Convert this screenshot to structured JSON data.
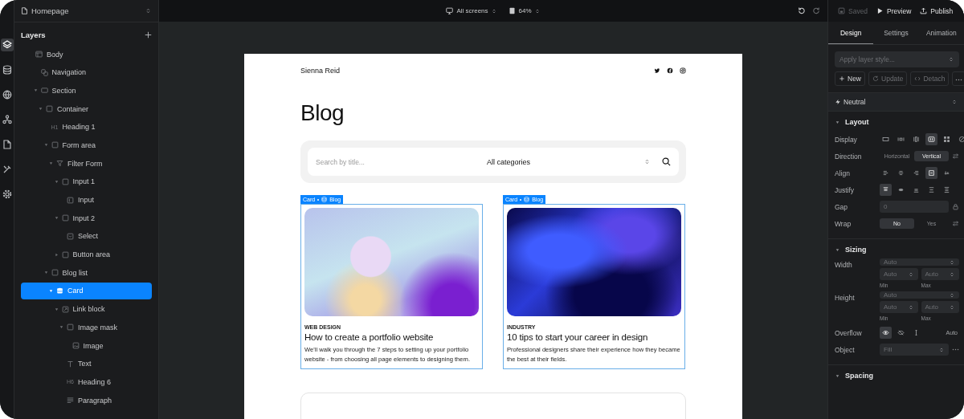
{
  "rail": [
    {
      "kind": "layers",
      "selected": true
    },
    {
      "kind": "database",
      "selected": false
    },
    {
      "kind": "globe",
      "selected": false
    },
    {
      "kind": "components",
      "selected": false
    },
    {
      "kind": "pages",
      "selected": false
    },
    {
      "kind": "tools",
      "selected": false
    },
    {
      "kind": "settings",
      "selected": false
    }
  ],
  "page_selector": {
    "label": "Homepage"
  },
  "layers": {
    "title": "Layers",
    "items": [
      {
        "label": "Body",
        "kind": "frame",
        "selected": false,
        "children": [
          {
            "label": "Navigation",
            "kind": "component",
            "selected": false
          },
          {
            "label": "Section",
            "kind": "section",
            "selected": false,
            "expanded": true,
            "children": [
              {
                "label": "Container",
                "kind": "box",
                "selected": false,
                "expanded": true,
                "children": [
                  {
                    "label": "Heading 1",
                    "kind": "heading",
                    "badge": "H1",
                    "selected": false
                  },
                  {
                    "label": "Form area",
                    "kind": "box",
                    "selected": false,
                    "expanded": true,
                    "children": [
                      {
                        "label": "Filter Form",
                        "kind": "filter",
                        "selected": false,
                        "expanded": true,
                        "children": [
                          {
                            "label": "Input 1",
                            "kind": "box",
                            "selected": false,
                            "expanded": true,
                            "children": [
                              {
                                "label": "Input",
                                "kind": "input",
                                "selected": false
                              }
                            ]
                          },
                          {
                            "label": "Input 2",
                            "kind": "box",
                            "selected": false,
                            "expanded": true,
                            "children": [
                              {
                                "label": "Select",
                                "kind": "select",
                                "selected": false
                              }
                            ]
                          },
                          {
                            "label": "Button area",
                            "kind": "box",
                            "selected": false,
                            "expanded": false
                          }
                        ]
                      }
                    ]
                  },
                  {
                    "label": "Blog list",
                    "kind": "box",
                    "selected": false,
                    "expanded": true,
                    "children": [
                      {
                        "label": "Card",
                        "kind": "collection",
                        "selected": true,
                        "expanded": true,
                        "children": [
                          {
                            "label": "Link block",
                            "kind": "link",
                            "selected": false,
                            "expanded": true,
                            "children": [
                              {
                                "label": "Image mask",
                                "kind": "box",
                                "selected": false,
                                "expanded": true,
                                "children": [
                                  {
                                    "label": "Image",
                                    "kind": "image",
                                    "selected": false
                                  }
                                ]
                              },
                              {
                                "label": "Text",
                                "kind": "text",
                                "selected": false
                              },
                              {
                                "label": "Heading 6",
                                "kind": "heading",
                                "badge": "H6",
                                "selected": false
                              },
                              {
                                "label": "Paragraph",
                                "kind": "paragraph",
                                "selected": false
                              }
                            ]
                          }
                        ]
                      }
                    ]
                  }
                ]
              }
            ]
          }
        ]
      }
    ]
  },
  "toolbar": {
    "screens": "All screens",
    "zoom": "64%"
  },
  "canvas": {
    "brand": "Sienna Reid",
    "heading": "Blog",
    "search": {
      "placeholder": "Search by title...",
      "category": "All categories"
    },
    "cards": [
      {
        "tag": {
          "element": "Card",
          "collection": "Blog"
        },
        "category": "WEB DESIGN",
        "title": "How to create a portfolio website",
        "text": "We'll walk you through the 7 steps to setting up your portfolio website - from choosing all page elements to designing them."
      },
      {
        "tag": {
          "element": "Card",
          "collection": "Blog"
        },
        "category": "INDUSTRY",
        "title": "10 tips to start your career in design",
        "text": "Professional designers share their experience how they became the best at their fields."
      }
    ]
  },
  "actions": [
    {
      "label": "Saved",
      "kind": "saved",
      "disabled": true
    },
    {
      "label": "Preview",
      "kind": "preview",
      "disabled": false
    },
    {
      "label": "Publish",
      "kind": "publish",
      "disabled": false
    }
  ],
  "tabs": [
    {
      "label": "Design",
      "selected": true
    },
    {
      "label": "Settings",
      "selected": false
    },
    {
      "label": "Animation",
      "selected": false
    }
  ],
  "layer_style": {
    "placeholder": "Apply layer style..."
  },
  "style_buttons": [
    {
      "label": "New",
      "kind": "new",
      "disabled": false
    },
    {
      "label": "Update",
      "kind": "update",
      "disabled": true
    },
    {
      "label": "Detach",
      "kind": "detach",
      "disabled": true
    }
  ],
  "variant": "Neutral",
  "layout": {
    "title": "Layout",
    "display": {
      "label": "Display",
      "options": [
        {
          "kind": "block",
          "selected": false
        },
        {
          "kind": "inline-block",
          "selected": false
        },
        {
          "kind": "inline",
          "selected": false
        },
        {
          "kind": "flex",
          "selected": true
        },
        {
          "kind": "grid",
          "selected": false
        },
        {
          "kind": "none",
          "selected": false
        }
      ]
    },
    "direction": {
      "label": "Direction",
      "options": [
        {
          "label": "Horizontal",
          "selected": false
        },
        {
          "label": "Vertical",
          "selected": true
        }
      ]
    },
    "align": {
      "label": "Align",
      "options": [
        {
          "kind": "start",
          "selected": false
        },
        {
          "kind": "center",
          "selected": false
        },
        {
          "kind": "end",
          "selected": false
        },
        {
          "kind": "stretch",
          "selected": true
        },
        {
          "kind": "baseline",
          "selected": false
        }
      ]
    },
    "justify": {
      "label": "Justify",
      "options": [
        {
          "kind": "start",
          "selected": true
        },
        {
          "kind": "center",
          "selected": false
        },
        {
          "kind": "end",
          "selected": false
        },
        {
          "kind": "between",
          "selected": false
        },
        {
          "kind": "around",
          "selected": false
        }
      ]
    },
    "gap": {
      "label": "Gap",
      "placeholder": "0"
    },
    "wrap": {
      "label": "Wrap",
      "options": [
        {
          "label": "No",
          "selected": true
        },
        {
          "label": "Yes",
          "selected": false
        }
      ]
    }
  },
  "sizing": {
    "title": "Sizing",
    "dims": [
      {
        "label": "Width",
        "placeholder": "Auto",
        "min": "Auto",
        "max": "Auto",
        "min_label": "Min",
        "max_label": "Max"
      },
      {
        "label": "Height",
        "placeholder": "Auto",
        "min": "Auto",
        "max": "Auto",
        "min_label": "Min",
        "max_label": "Max"
      }
    ],
    "overflow": {
      "label": "Overflow",
      "options": [
        {
          "kind": "visible",
          "selected": true
        },
        {
          "kind": "hidden",
          "selected": false
        },
        {
          "kind": "scroll",
          "selected": false
        },
        {
          "kind": "auto",
          "label": "Auto",
          "selected": false
        }
      ]
    },
    "object": {
      "label": "Object",
      "placeholder": "Fill"
    }
  },
  "spacing": {
    "title": "Spacing"
  }
}
